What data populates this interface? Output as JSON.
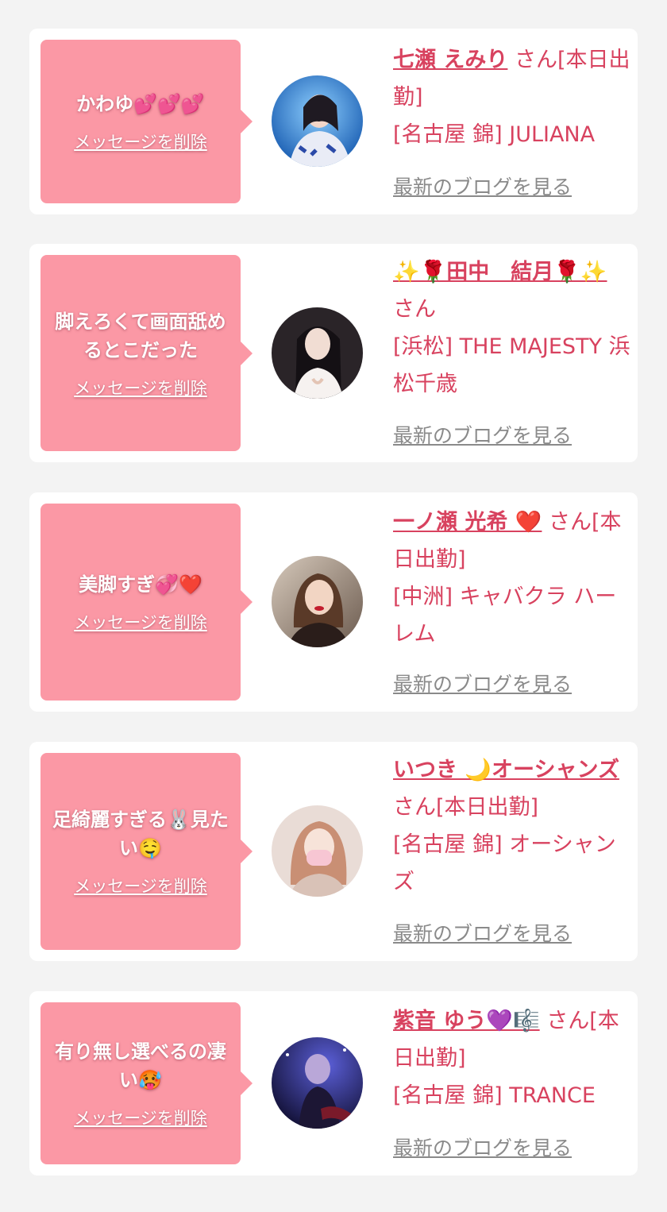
{
  "delete_label": "メッセージを削除",
  "blog_label": "最新のブログを見る",
  "colors": {
    "bubble": "#fb98a5",
    "accent": "#d8425f",
    "link_gray": "#8a8a8a",
    "card": "#ffffff",
    "background": "#f3f3f3"
  },
  "messages": [
    {
      "text": "かわゆ💕💕💕",
      "name": "七瀬 えみり",
      "suffix": "さん[本日出勤]",
      "shop": "[名古屋 錦] JULIANA"
    },
    {
      "text": "脚えろくて画面舐めるとこだった",
      "name": "✨🌹田中　結月🌹✨",
      "suffix": "さん",
      "shop": "[浜松] THE MAJESTY 浜松千歳"
    },
    {
      "text": "美脚すぎ💞❤️",
      "name": "一ノ瀬 光希 ❤️",
      "suffix": "さん[本日出勤]",
      "shop": "[中洲] キャバクラ ハーレム"
    },
    {
      "text": "足綺麗すぎる🐰見たい🤤",
      "name": "いつき 🌙オーシャンズ",
      "suffix": "さん[本日出勤]",
      "shop": "[名古屋 錦] オーシャンズ"
    },
    {
      "text": "有り無し選べるの凄い🥵",
      "name": "紫音 ゆう💜🎼",
      "suffix": "さん[本日出勤]",
      "shop": "[名古屋 錦] TRANCE"
    }
  ]
}
